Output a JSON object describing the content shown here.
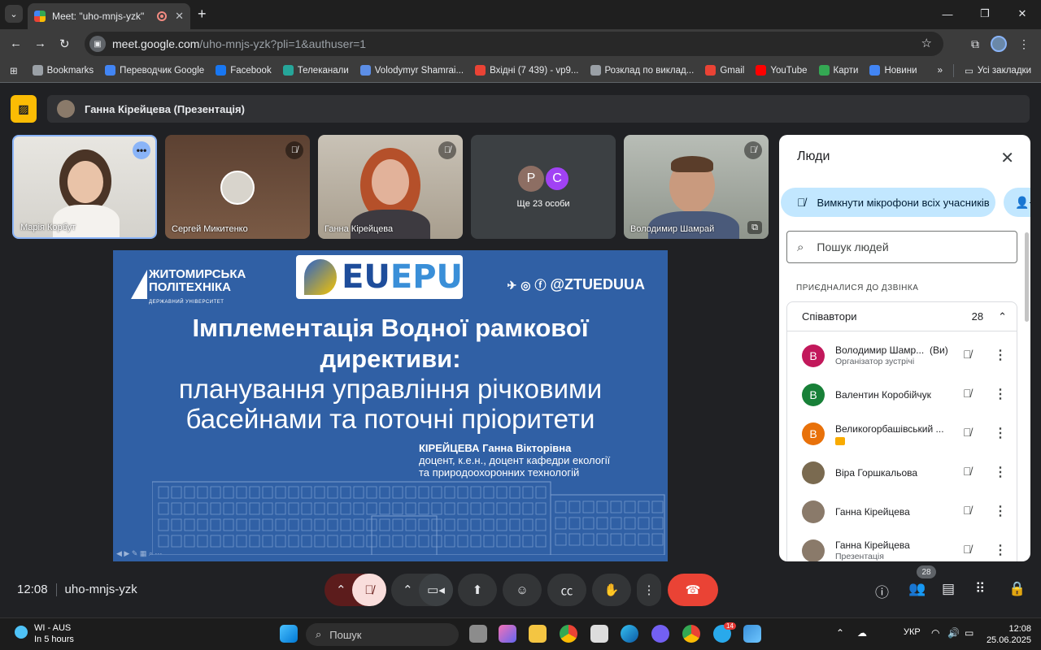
{
  "browser": {
    "tab_title": "Meet: \"uho-mnjs-yzk\"",
    "url_main": "meet.google.com",
    "url_path": "/uho-mnjs-yzk?pli=1&authuser=1"
  },
  "bookmarks": [
    {
      "label": "Bookmarks",
      "icon": "star-icon",
      "color": "#9aa0a6"
    },
    {
      "label": "Переводчик Google",
      "icon": "translate-icon",
      "color": "#4285f4"
    },
    {
      "label": "Facebook",
      "icon": "facebook-icon",
      "color": "#1877f2"
    },
    {
      "label": "Телеканали",
      "icon": "tv-icon",
      "color": "#26a69a"
    },
    {
      "label": "Volodymyr Shamrai...",
      "icon": "diamond-icon",
      "color": "#5c8ee6"
    },
    {
      "label": "Вхідні (7 439) - vp9...",
      "icon": "gmail-icon",
      "color": "#ea4335"
    },
    {
      "label": "Розклад по виклад...",
      "icon": "globe-icon",
      "color": "#9aa0a6"
    },
    {
      "label": "Gmail",
      "icon": "gmail-icon",
      "color": "#ea4335"
    },
    {
      "label": "YouTube",
      "icon": "youtube-icon",
      "color": "#ff0000"
    },
    {
      "label": "Карти",
      "icon": "maps-icon",
      "color": "#34a853"
    },
    {
      "label": "Новини",
      "icon": "news-icon",
      "color": "#4285f4"
    }
  ],
  "bookmarks_all": "Усі закладки",
  "meet": {
    "presenter_bar": "Ганна Кірейцева (Презентація)",
    "tiles": [
      {
        "name": "Марія Корбут"
      },
      {
        "name": "Сергей Микитенко"
      },
      {
        "name": "Ганна Кірейцева"
      },
      {
        "name": "Ще 23 особи",
        "initials": [
          "Р",
          "С"
        ]
      },
      {
        "name": "Володимир Шамрай"
      }
    ],
    "meeting_time": "12:08",
    "meeting_code": "uho-mnjs-yzk",
    "participants_badge": "28"
  },
  "slide": {
    "logo_line1": "ЖИТОМИРСЬКА",
    "logo_line2": "ПОЛІТЕХНІКА",
    "logo_sub": "ДЕРЖАВНИЙ УНІВЕРСИТЕТ",
    "brand_eu": "EU",
    "brand_epu": "EPU",
    "social": "@ZTUEDUUA",
    "title_line1": "Імплементація Водної рамкової",
    "title_line2": "директиви:",
    "subtitle_line1": "планування управління річковими",
    "subtitle_line2": "басейнами та поточні пріоритети",
    "author_name": "КІРЕЙЦЕВА Ганна Вікторівна",
    "author_pos1": "доцент, к.е.н., доцент кафедри екології",
    "author_pos2": "та природоохоронних технологій"
  },
  "people_panel": {
    "title": "Люди",
    "mute_all": "Вимкнути мікрофони всіх учасників",
    "search_placeholder": "Пошук людей",
    "joined_header": "ПРИЄДНАЛИСЯ ДО ДЗВІНКА",
    "cohosts_label": "Співавтори",
    "cohosts_count": "28",
    "you_label": "(Ви)",
    "people": [
      {
        "name": "Володимир Шамр...",
        "sub": "Організатор зустрічі",
        "initial": "В",
        "color": "#c2185b",
        "you": true
      },
      {
        "name": "Валентин Коробійчук",
        "sub": "",
        "initial": "В",
        "color": "#188038"
      },
      {
        "name": "Великогорбашівський ...",
        "sub": "",
        "initial": "В",
        "color": "#e8710a",
        "badge": true
      },
      {
        "name": "Віра Горшкальова",
        "sub": "",
        "initial": "",
        "color": "#7a6a50"
      },
      {
        "name": "Ганна Кірейцева",
        "sub": "",
        "initial": "",
        "color": "#8a7a6a"
      },
      {
        "name": "Ганна Кірейцева",
        "sub": "Презентація",
        "initial": "",
        "color": "#8a7a6a"
      }
    ]
  },
  "taskbar": {
    "weather_title": "WI - AUS",
    "weather_sub": "In 5 hours",
    "search": "Пошук",
    "lang": "УКР",
    "time": "12:08",
    "date": "25.06.2025",
    "telegram_badge": "14"
  }
}
